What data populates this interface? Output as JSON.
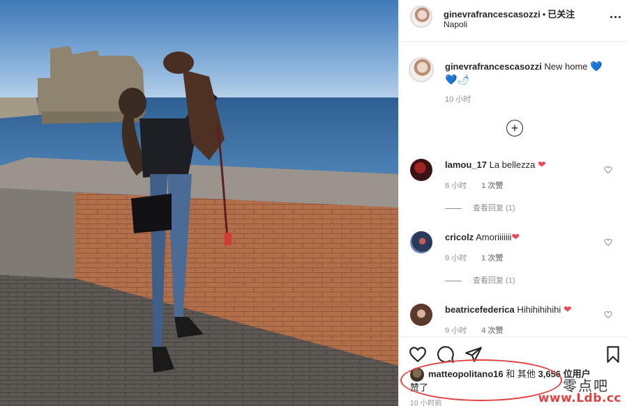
{
  "post": {
    "username": "ginevrafrancescasozzi",
    "separator": "•",
    "follow_status": "已关注",
    "location": "Napoli"
  },
  "caption": {
    "username": "ginevrafrancescasozzi",
    "text": "New home",
    "emoji_1": "💙",
    "emoji_2": "💙🌶",
    "time": "10 小时"
  },
  "comments": [
    {
      "username": "lamou_17",
      "text": "La bellezza",
      "emoji": "❤",
      "time": "8 小时",
      "likes": "1 次赞",
      "view_replies": "查看回复 (1)"
    },
    {
      "username": "cricolz",
      "text": "Amoriiiiiii",
      "emoji": "❤",
      "time": "9 小时",
      "likes": "1 次赞",
      "view_replies": "查看回复 (1)"
    },
    {
      "username": "beatricefederica",
      "text": "Hihihihihihi",
      "emoji": "❤",
      "time": "9 小时",
      "likes": "4 次赞"
    }
  ],
  "likes": {
    "username": "matteopolitano16",
    "and_text": "和 其他",
    "count": "3,656 位用户",
    "suffix": "赞了"
  },
  "post_time": "10 小时前",
  "watermark": {
    "cn": "零点吧",
    "url": "www.Ldb.cc"
  },
  "colors": {
    "accent_blue": "#3897f0",
    "heart_red": "#ed4956",
    "circle_red": "#e0413d",
    "muted": "#8e8e8e",
    "border": "#efefef"
  },
  "icons": [
    "more-icon",
    "add-circle-icon",
    "heart-icon",
    "comment-icon",
    "share-icon",
    "bookmark-icon"
  ]
}
